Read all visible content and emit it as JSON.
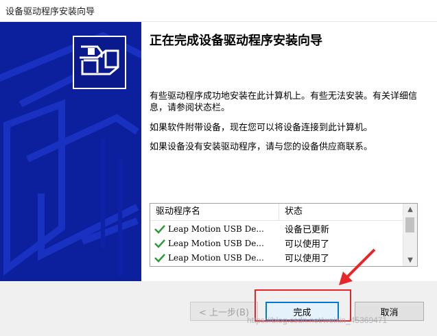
{
  "window": {
    "title": "设备驱动程序安装向导"
  },
  "main": {
    "heading": "正在完成设备驱动程序安装向导",
    "paragraph1": "有些驱动程序成功地安装在此计算机上。有些无法安装。有关详细信息，请参阅状态栏。",
    "paragraph2": "如果软件附带设备，现在您可以将设备连接到此计算机。",
    "paragraph3": "如果设备没有安装驱动程序，请与您的设备供应商联系。"
  },
  "driver_list": {
    "columns": [
      "驱动程序名",
      "状态"
    ],
    "rows": [
      {
        "name": "Leap Motion USB De...",
        "status": "设备已更新"
      },
      {
        "name": "Leap Motion USB De...",
        "status": "可以使用了"
      },
      {
        "name": "Leap Motion USB De...",
        "status": "可以使用了"
      }
    ]
  },
  "buttons": {
    "back": "< 上一步(B)",
    "finish": "完成",
    "cancel": "取消"
  },
  "watermark": "https://blog.csdn.net/weixin_45369471",
  "colors": {
    "left_panel": "#0c1f9c",
    "check": "#2e9a3c",
    "highlight": "#e8262a",
    "default_button_border": "#0078d7"
  }
}
